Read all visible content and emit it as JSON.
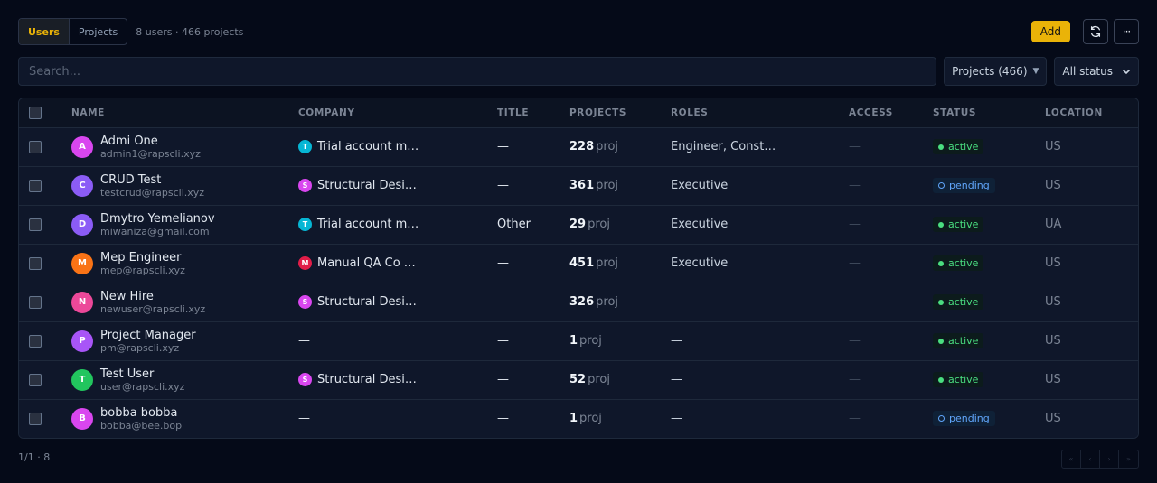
{
  "header": {
    "tabs": [
      {
        "label": "Users"
      },
      {
        "label": "Projects"
      }
    ],
    "summary": "8 users · 466 projects",
    "add_label": "Add",
    "refresh_icon": "refresh-icon",
    "more_icon": "more-icon",
    "more_glyph": "···"
  },
  "search": {
    "placeholder": "Search..."
  },
  "filters": {
    "projects": "Projects (466)",
    "status": "All status"
  },
  "table": {
    "columns": [
      "NAME",
      "COMPANY",
      "TITLE",
      "PROJECTS",
      "ROLES",
      "ACCESS",
      "STATUS",
      "LOCATION"
    ],
    "rows": [
      {
        "initial": "A",
        "avatar_color": "#d946ef",
        "name": "Admi One",
        "email": "admin1@rapscli.xyz",
        "company_initial": "T",
        "company_color": "#06b6d4",
        "company": "Trial account m…",
        "title": "—",
        "projects": "228",
        "proj_unit": "proj",
        "roles": "Engineer, Const…",
        "access": "—",
        "status": "active",
        "location": "US"
      },
      {
        "initial": "C",
        "avatar_color": "#8b5cf6",
        "name": "CRUD Test",
        "email": "testcrud@rapscli.xyz",
        "company_initial": "S",
        "company_color": "#d946ef",
        "company": "Structural Desi…",
        "title": "—",
        "projects": "361",
        "proj_unit": "proj",
        "roles": "Executive",
        "access": "—",
        "status": "pending",
        "location": "US"
      },
      {
        "initial": "D",
        "avatar_color": "#8b5cf6",
        "name": "Dmytro Yemelianov",
        "email": "miwaniza@gmail.com",
        "company_initial": "T",
        "company_color": "#06b6d4",
        "company": "Trial account m…",
        "title": "Other",
        "projects": "29",
        "proj_unit": "proj",
        "roles": "Executive",
        "access": "—",
        "status": "active",
        "location": "UA"
      },
      {
        "initial": "M",
        "avatar_color": "#f97316",
        "name": "Mep Engineer",
        "email": "mep@rapscli.xyz",
        "company_initial": "M",
        "company_color": "#e11d48",
        "company": "Manual QA Co …",
        "title": "—",
        "projects": "451",
        "proj_unit": "proj",
        "roles": "Executive",
        "access": "—",
        "status": "active",
        "location": "US"
      },
      {
        "initial": "N",
        "avatar_color": "#ec4899",
        "name": "New Hire",
        "email": "newuser@rapscli.xyz",
        "company_initial": "S",
        "company_color": "#d946ef",
        "company": "Structural Desi…",
        "title": "—",
        "projects": "326",
        "proj_unit": "proj",
        "roles": "—",
        "access": "—",
        "status": "active",
        "location": "US"
      },
      {
        "initial": "P",
        "avatar_color": "#a855f7",
        "name": "Project Manager",
        "email": "pm@rapscli.xyz",
        "company_initial": "",
        "company_color": "",
        "company": "—",
        "title": "—",
        "projects": "1",
        "proj_unit": "proj",
        "roles": "—",
        "access": "—",
        "status": "active",
        "location": "US"
      },
      {
        "initial": "T",
        "avatar_color": "#22c55e",
        "name": "Test User",
        "email": "user@rapscli.xyz",
        "company_initial": "S",
        "company_color": "#d946ef",
        "company": "Structural Desi…",
        "title": "—",
        "projects": "52",
        "proj_unit": "proj",
        "roles": "—",
        "access": "—",
        "status": "active",
        "location": "US"
      },
      {
        "initial": "B",
        "avatar_color": "#d946ef",
        "name": "bobba bobba",
        "email": "bobba@bee.bop",
        "company_initial": "",
        "company_color": "",
        "company": "—",
        "title": "—",
        "projects": "1",
        "proj_unit": "proj",
        "roles": "—",
        "access": "—",
        "status": "pending",
        "location": "US"
      }
    ]
  },
  "footer": {
    "page_info": "1/1 · 8"
  },
  "pager": {
    "buttons": [
      "«",
      "‹",
      "›",
      "»"
    ]
  },
  "colors": {
    "accent": "#eab308",
    "active": "#4ade80",
    "pending": "#60a5fa",
    "background": "#050a18"
  }
}
